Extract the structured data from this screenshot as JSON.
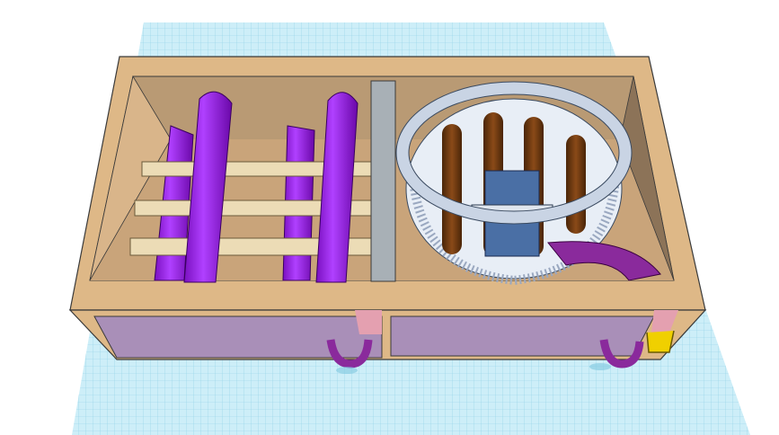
{
  "viewport": {
    "type": "3d-workplane-view"
  },
  "colors": {
    "grid": "#bfe6f2",
    "grid_line": "#8fd0e6",
    "box_wood": "#deb887",
    "box_inner": "#c9a47a",
    "box_dark": "#8c7358",
    "drawer_front": "#a98fb8",
    "drawer_tab": "#e4a0b0",
    "rail_purple": "#9a1ee0",
    "dowel": "#ecdcb6",
    "divider": "#a8b0b6",
    "drum": "#c9d4e4",
    "rod": "#6e3a10",
    "paddle": "#4a6fa5",
    "hook": "#8a2a9c",
    "clip": "#f0d000"
  }
}
